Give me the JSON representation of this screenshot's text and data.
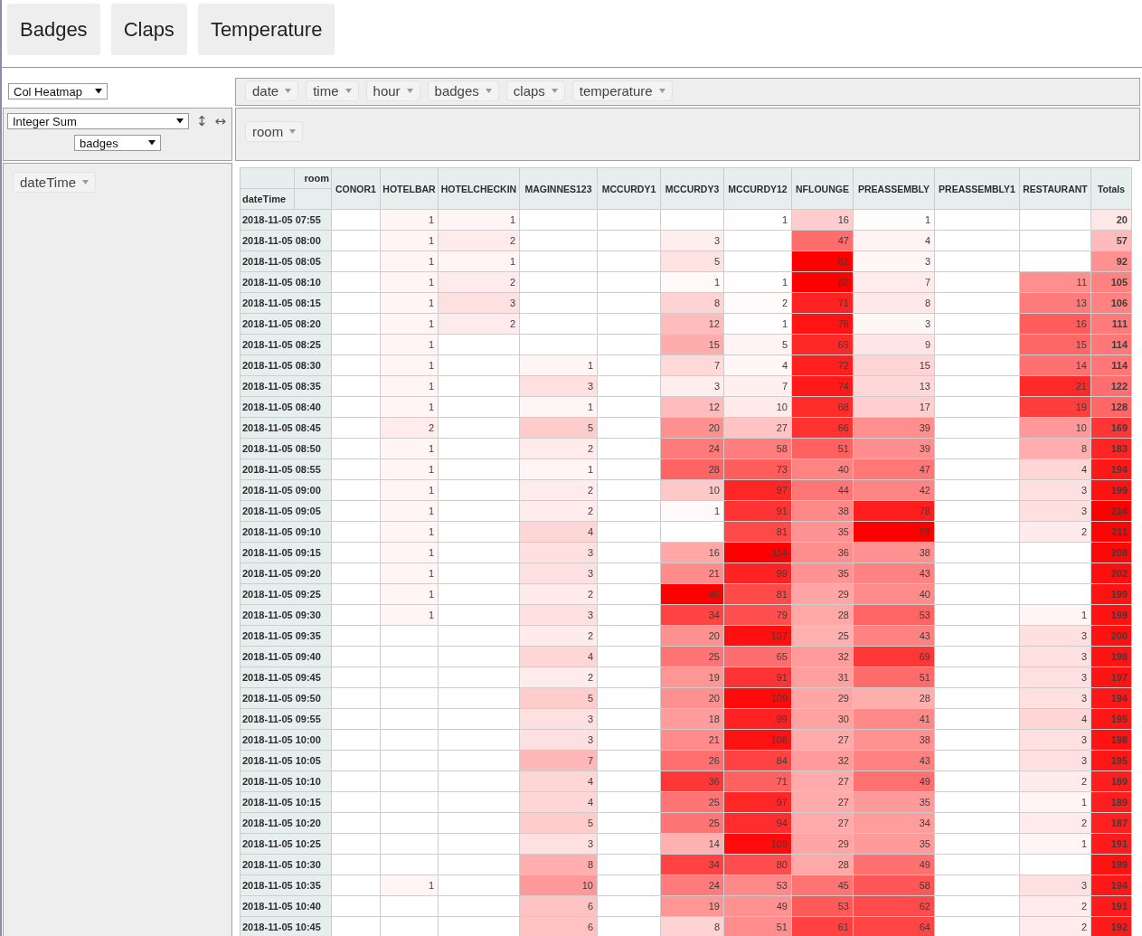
{
  "top_buttons": [
    "Badges",
    "Claps",
    "Temperature"
  ],
  "renderer": {
    "value": "Col Heatmap"
  },
  "unused_attributes": [
    "date",
    "time",
    "hour",
    "badges",
    "claps",
    "temperature"
  ],
  "aggregator": {
    "value": "Integer Sum",
    "attribute": "badges",
    "row_order_icon": "↕",
    "col_order_icon": "↔"
  },
  "column_attributes": [
    "room"
  ],
  "row_attributes": [
    "dateTime"
  ],
  "table": {
    "col_attr_label": "room",
    "row_attr_label": "dateTime",
    "columns": [
      "CONOR1",
      "HOTELBAR",
      "HOTELCHECKIN",
      "MAGINNES123",
      "MCCURDY1",
      "MCCURDY3",
      "MCCURDY12",
      "NFLOUNGE",
      "PREASSEMBLY",
      "PREASSEMBLY1",
      "RESTAURANT"
    ],
    "totals_label": "Totals",
    "rows": [
      {
        "label": "2018-11-05 07:55",
        "cells": [
          null,
          "1",
          "1",
          null,
          null,
          null,
          "1",
          "16",
          "1",
          null,
          null
        ],
        "total": "20"
      },
      {
        "label": "2018-11-05 08:00",
        "cells": [
          null,
          "1",
          "2",
          null,
          null,
          "3",
          null,
          "47",
          "4",
          null,
          null
        ],
        "total": "57"
      },
      {
        "label": "2018-11-05 08:05",
        "cells": [
          null,
          "1",
          "1",
          null,
          null,
          "5",
          null,
          "82",
          "3",
          null,
          null
        ],
        "total": "92"
      },
      {
        "label": "2018-11-05 08:10",
        "cells": [
          null,
          "1",
          "2",
          null,
          null,
          "1",
          "1",
          "82",
          "7",
          null,
          "11"
        ],
        "total": "105"
      },
      {
        "label": "2018-11-05 08:15",
        "cells": [
          null,
          "1",
          "3",
          null,
          null,
          "8",
          "2",
          "71",
          "8",
          null,
          "13"
        ],
        "total": "106"
      },
      {
        "label": "2018-11-05 08:20",
        "cells": [
          null,
          "1",
          "2",
          null,
          null,
          "12",
          "1",
          "76",
          "3",
          null,
          "16"
        ],
        "total": "111"
      },
      {
        "label": "2018-11-05 08:25",
        "cells": [
          null,
          "1",
          null,
          null,
          null,
          "15",
          "5",
          "69",
          "9",
          null,
          "15"
        ],
        "total": "114"
      },
      {
        "label": "2018-11-05 08:30",
        "cells": [
          null,
          "1",
          null,
          "1",
          null,
          "7",
          "4",
          "72",
          "15",
          null,
          "14"
        ],
        "total": "114"
      },
      {
        "label": "2018-11-05 08:35",
        "cells": [
          null,
          "1",
          null,
          "3",
          null,
          "3",
          "7",
          "74",
          "13",
          null,
          "21"
        ],
        "total": "122"
      },
      {
        "label": "2018-11-05 08:40",
        "cells": [
          null,
          "1",
          null,
          "1",
          null,
          "12",
          "10",
          "68",
          "17",
          null,
          "19"
        ],
        "total": "128"
      },
      {
        "label": "2018-11-05 08:45",
        "cells": [
          null,
          "2",
          null,
          "5",
          null,
          "20",
          "27",
          "66",
          "39",
          null,
          "10"
        ],
        "total": "169"
      },
      {
        "label": "2018-11-05 08:50",
        "cells": [
          null,
          "1",
          null,
          "2",
          null,
          "24",
          "58",
          "51",
          "39",
          null,
          "8"
        ],
        "total": "183"
      },
      {
        "label": "2018-11-05 08:55",
        "cells": [
          null,
          "1",
          null,
          "1",
          null,
          "28",
          "73",
          "40",
          "47",
          null,
          "4"
        ],
        "total": "194"
      },
      {
        "label": "2018-11-05 09:00",
        "cells": [
          null,
          "1",
          null,
          "2",
          null,
          "10",
          "97",
          "44",
          "42",
          null,
          "3"
        ],
        "total": "199"
      },
      {
        "label": "2018-11-05 09:05",
        "cells": [
          null,
          "1",
          null,
          "2",
          null,
          "1",
          "91",
          "38",
          "78",
          null,
          "3"
        ],
        "total": "214"
      },
      {
        "label": "2018-11-05 09:10",
        "cells": [
          null,
          "1",
          null,
          "4",
          null,
          null,
          "81",
          "35",
          "88",
          null,
          "2"
        ],
        "total": "211"
      },
      {
        "label": "2018-11-05 09:15",
        "cells": [
          null,
          "1",
          null,
          "3",
          null,
          "16",
          "114",
          "36",
          "38",
          null,
          null
        ],
        "total": "208"
      },
      {
        "label": "2018-11-05 09:20",
        "cells": [
          null,
          "1",
          null,
          "3",
          null,
          "21",
          "99",
          "35",
          "43",
          null,
          null
        ],
        "total": "202"
      },
      {
        "label": "2018-11-05 09:25",
        "cells": [
          null,
          "1",
          null,
          "2",
          null,
          "46",
          "81",
          "29",
          "40",
          null,
          null
        ],
        "total": "199"
      },
      {
        "label": "2018-11-05 09:30",
        "cells": [
          null,
          "1",
          null,
          "3",
          null,
          "34",
          "79",
          "28",
          "53",
          null,
          "1"
        ],
        "total": "199"
      },
      {
        "label": "2018-11-05 09:35",
        "cells": [
          null,
          null,
          null,
          "2",
          null,
          "20",
          "107",
          "25",
          "43",
          null,
          "3"
        ],
        "total": "200"
      },
      {
        "label": "2018-11-05 09:40",
        "cells": [
          null,
          null,
          null,
          "4",
          null,
          "25",
          "65",
          "32",
          "69",
          null,
          "3"
        ],
        "total": "198"
      },
      {
        "label": "2018-11-05 09:45",
        "cells": [
          null,
          null,
          null,
          "2",
          null,
          "19",
          "91",
          "31",
          "51",
          null,
          "3"
        ],
        "total": "197"
      },
      {
        "label": "2018-11-05 09:50",
        "cells": [
          null,
          null,
          null,
          "5",
          null,
          "20",
          "109",
          "29",
          "28",
          null,
          "3"
        ],
        "total": "194"
      },
      {
        "label": "2018-11-05 09:55",
        "cells": [
          null,
          null,
          null,
          "3",
          null,
          "18",
          "99",
          "30",
          "41",
          null,
          "4"
        ],
        "total": "195"
      },
      {
        "label": "2018-11-05 10:00",
        "cells": [
          null,
          null,
          null,
          "3",
          null,
          "21",
          "106",
          "27",
          "38",
          null,
          "3"
        ],
        "total": "198"
      },
      {
        "label": "2018-11-05 10:05",
        "cells": [
          null,
          null,
          null,
          "7",
          null,
          "26",
          "84",
          "32",
          "43",
          null,
          "3"
        ],
        "total": "195"
      },
      {
        "label": "2018-11-05 10:10",
        "cells": [
          null,
          null,
          null,
          "4",
          null,
          "36",
          "71",
          "27",
          "49",
          null,
          "2"
        ],
        "total": "189"
      },
      {
        "label": "2018-11-05 10:15",
        "cells": [
          null,
          null,
          null,
          "4",
          null,
          "25",
          "97",
          "27",
          "35",
          null,
          "1"
        ],
        "total": "189"
      },
      {
        "label": "2018-11-05 10:20",
        "cells": [
          null,
          null,
          null,
          "5",
          null,
          "25",
          "94",
          "27",
          "34",
          null,
          "2"
        ],
        "total": "187"
      },
      {
        "label": "2018-11-05 10:25",
        "cells": [
          null,
          null,
          null,
          "3",
          null,
          "14",
          "109",
          "29",
          "35",
          null,
          "1"
        ],
        "total": "191"
      },
      {
        "label": "2018-11-05 10:30",
        "cells": [
          null,
          null,
          null,
          "8",
          null,
          "34",
          "80",
          "28",
          "49",
          null,
          null
        ],
        "total": "199"
      },
      {
        "label": "2018-11-05 10:35",
        "cells": [
          null,
          "1",
          null,
          "10",
          null,
          "24",
          "53",
          "45",
          "58",
          null,
          "3"
        ],
        "total": "194"
      },
      {
        "label": "2018-11-05 10:40",
        "cells": [
          null,
          null,
          null,
          "6",
          null,
          "19",
          "49",
          "53",
          "62",
          null,
          "2"
        ],
        "total": "191"
      },
      {
        "label": "2018-11-05 10:45",
        "cells": [
          null,
          null,
          null,
          "6",
          null,
          "8",
          "51",
          "61",
          "64",
          null,
          "2"
        ],
        "total": "192"
      }
    ]
  }
}
